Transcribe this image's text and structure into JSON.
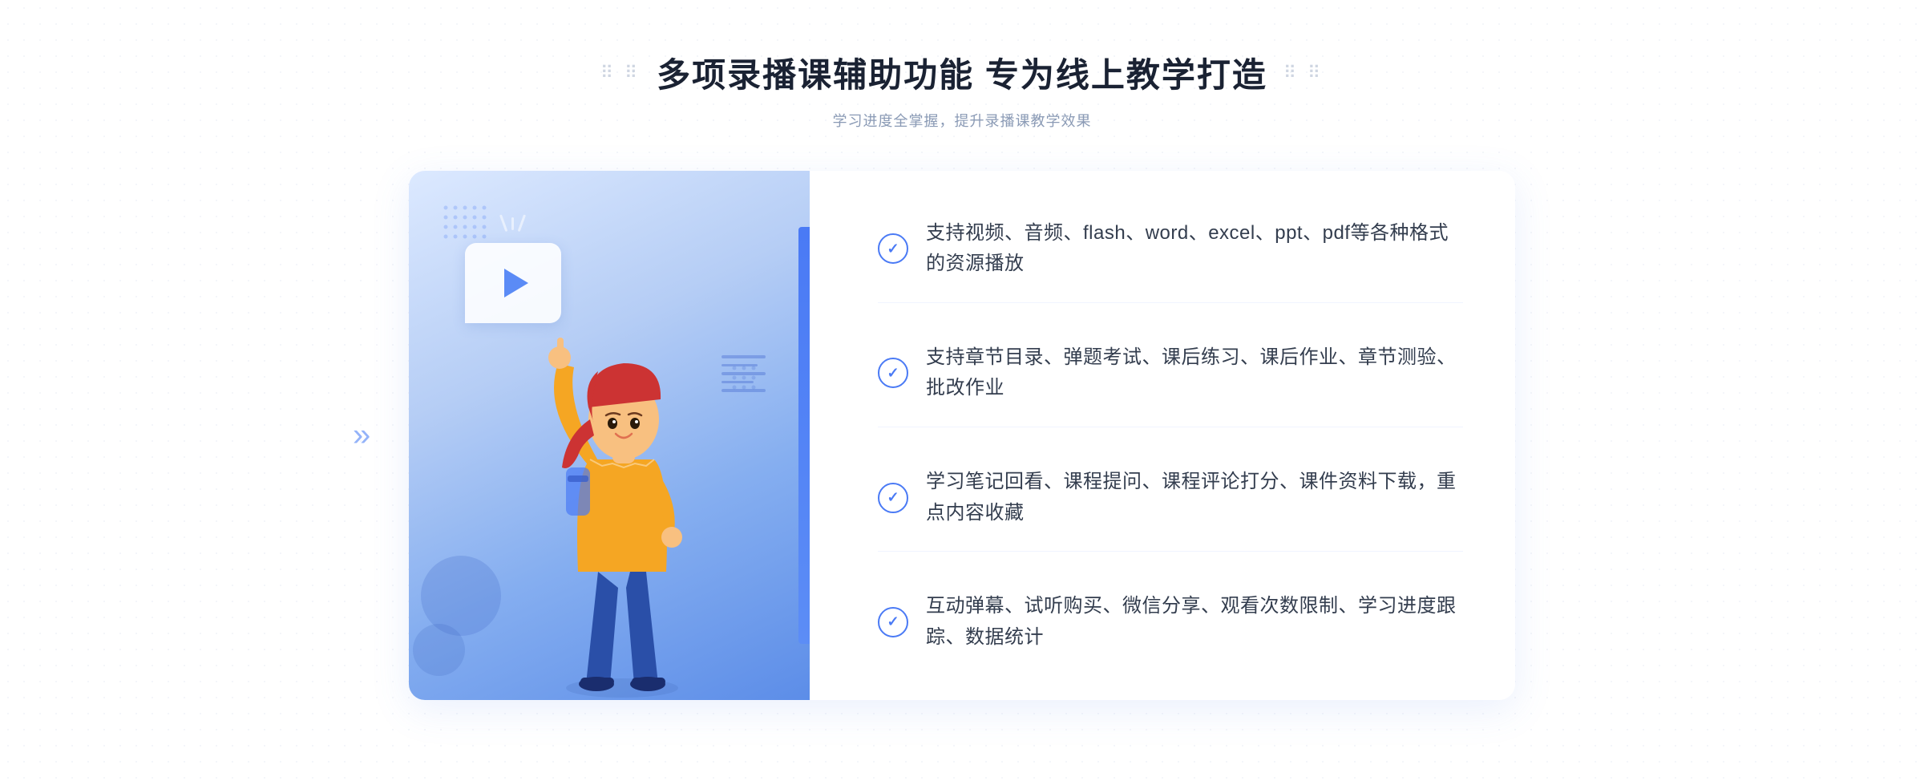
{
  "header": {
    "main_title": "多项录播课辅助功能 专为线上教学打造",
    "sub_title": "学习进度全掌握，提升录播课教学效果",
    "dots_left": "⠿⠿",
    "dots_right": "⠿⠿"
  },
  "features": [
    {
      "id": 1,
      "text": "支持视频、音频、flash、word、excel、ppt、pdf等各种格式的资源播放"
    },
    {
      "id": 2,
      "text": "支持章节目录、弹题考试、课后练习、课后作业、章节测验、批改作业"
    },
    {
      "id": 3,
      "text": "学习笔记回看、课程提问、课程评论打分、课件资料下载，重点内容收藏"
    },
    {
      "id": 4,
      "text": "互动弹幕、试听购买、微信分享、观看次数限制、学习进度跟踪、数据统计"
    }
  ],
  "colors": {
    "primary_blue": "#4a7af5",
    "light_blue_bg": "#dce8ff",
    "title_dark": "#1a2233",
    "text_gray": "#8a9ab5",
    "feature_text": "#333d4e"
  },
  "icons": {
    "play": "▶",
    "check": "✓",
    "arrow_right": "»",
    "dots": "⠿"
  }
}
